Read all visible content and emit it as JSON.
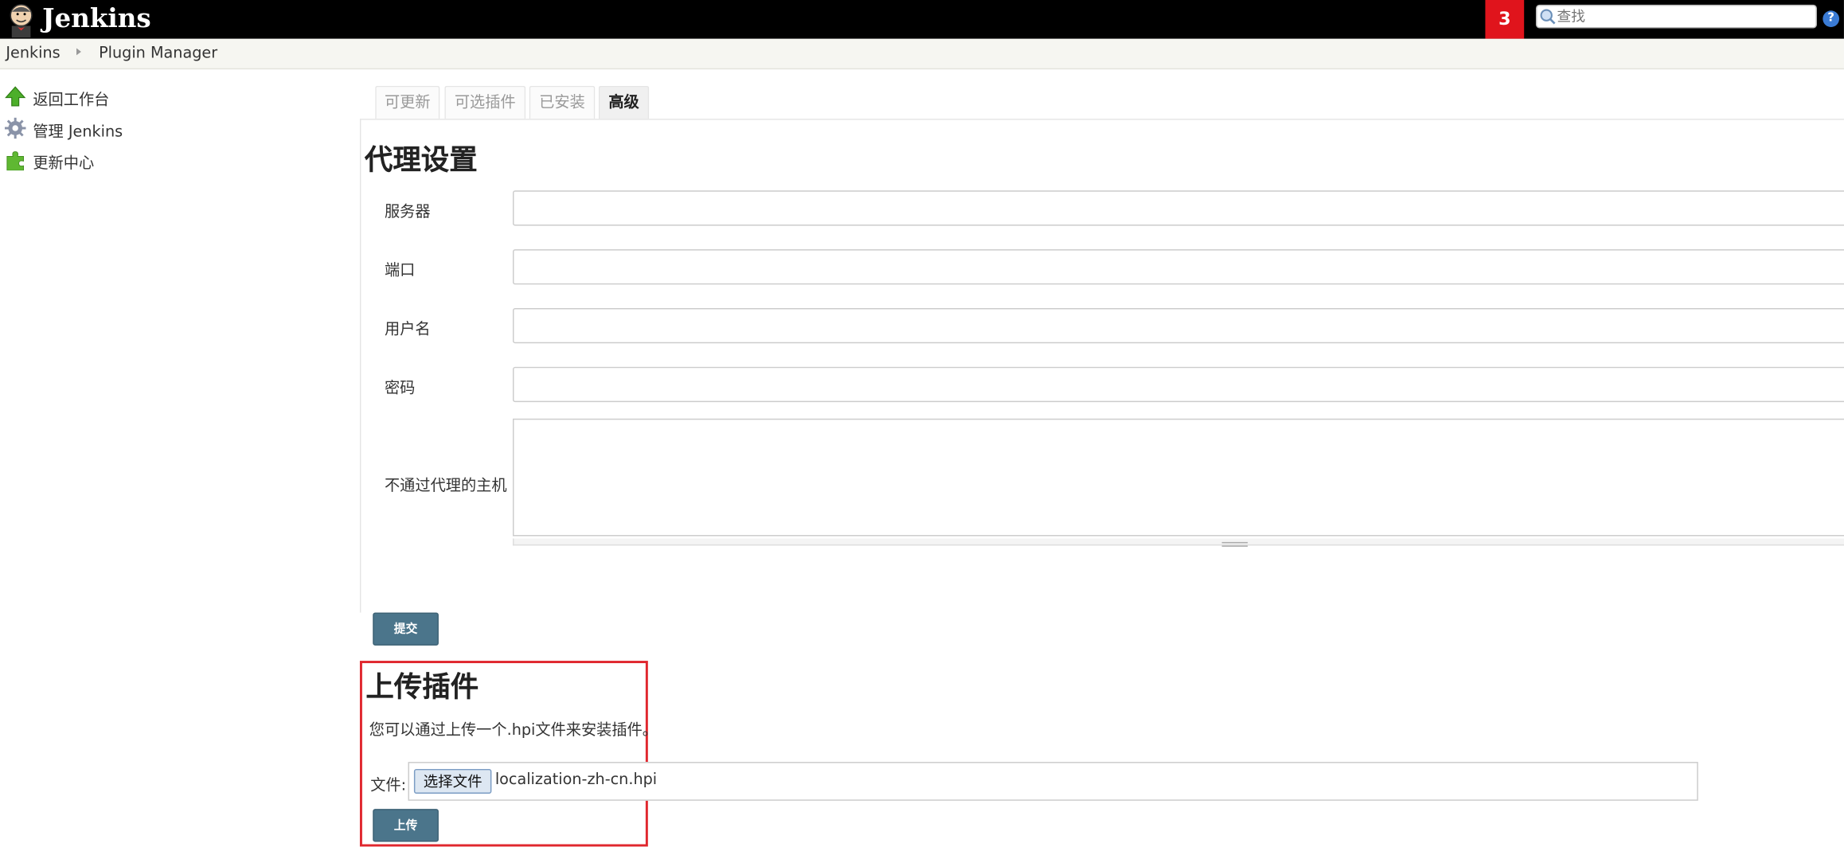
{
  "header": {
    "brand": "Jenkins",
    "notification_count": "3",
    "search_placeholder": "查找",
    "help_glyph": "?"
  },
  "breadcrumb": {
    "home": "Jenkins",
    "page": "Plugin Manager"
  },
  "sidebar": {
    "items": [
      {
        "label": "返回工作台",
        "icon": "up-arrow-icon"
      },
      {
        "label": "管理 Jenkins",
        "icon": "gear-icon"
      },
      {
        "label": "更新中心",
        "icon": "puzzle-icon"
      }
    ]
  },
  "tabs": [
    {
      "label": "可更新",
      "active": false
    },
    {
      "label": "可选插件",
      "active": false
    },
    {
      "label": "已安装",
      "active": false
    },
    {
      "label": "高级",
      "active": true
    }
  ],
  "proxy": {
    "title": "代理设置",
    "fields": [
      {
        "label": "服务器",
        "value": ""
      },
      {
        "label": "端口",
        "value": ""
      },
      {
        "label": "用户名",
        "value": ""
      },
      {
        "label": "密码",
        "value": ""
      },
      {
        "label": "不通过代理的主机",
        "value": ""
      }
    ],
    "submit_label": "提交"
  },
  "upload": {
    "title": "上传插件",
    "description": "您可以通过上传一个.hpi文件来安装插件。",
    "file_label": "文件:",
    "choose_label": "选择文件",
    "file_name": "localization-zh-cn.hpi",
    "upload_label": "上传"
  },
  "colors": {
    "header_bg": "#000000",
    "badge": "#e0141c",
    "button": "#4b758b",
    "highlight_border": "#e0272e"
  }
}
